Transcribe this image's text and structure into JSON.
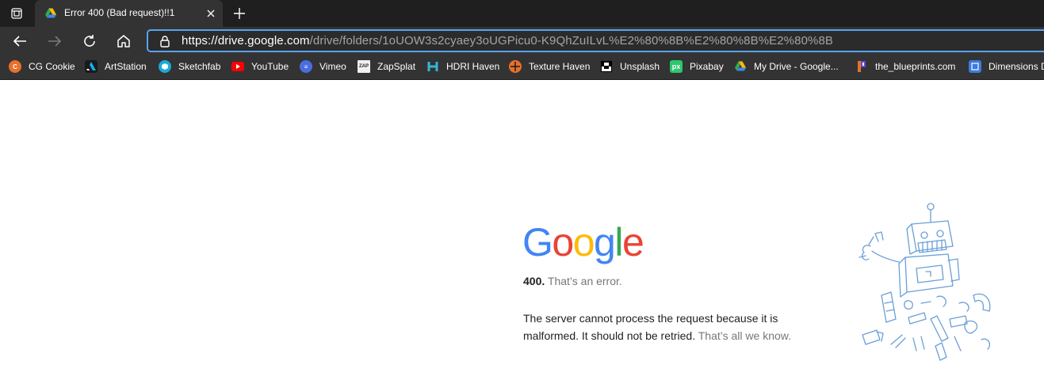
{
  "tab": {
    "title": "Error 400 (Bad request)!!1",
    "favicon": "google-drive-icon"
  },
  "toolbar": {
    "url_host": "https://drive.google.com",
    "url_path": "/drive/folders/1oUOW3s2cyaey3oUGPicu0-K9QhZuILvL%E2%80%8B%E2%80%8B%E2%80%8B"
  },
  "bookmarks": [
    {
      "label": "CG Cookie",
      "icon": "cgcookie-icon",
      "color": "#e8702a"
    },
    {
      "label": "ArtStation",
      "icon": "artstation-icon",
      "color": "#13aff0"
    },
    {
      "label": "Sketchfab",
      "icon": "sketchfab-icon",
      "color": "#1caad9"
    },
    {
      "label": "YouTube",
      "icon": "youtube-icon",
      "color": "#ff0000"
    },
    {
      "label": "Vimeo",
      "icon": "vimeo-icon",
      "color": "#4a6ee0"
    },
    {
      "label": "ZapSplat",
      "icon": "zapsplat-icon",
      "color": "#f0f0f0"
    },
    {
      "label": "HDRI Haven",
      "icon": "hdrihaven-icon",
      "color": "#36b5d8"
    },
    {
      "label": "Texture Haven",
      "icon": "texturehaven-icon",
      "color": "#e8702a"
    },
    {
      "label": "Unsplash",
      "icon": "unsplash-icon",
      "color": "#000000"
    },
    {
      "label": "Pixabay",
      "icon": "pixabay-icon",
      "color": "#2ec66e"
    },
    {
      "label": "My Drive - Google...",
      "icon": "google-drive-icon",
      "color": "#fbbc05"
    },
    {
      "label": "the_blueprints.com",
      "icon": "blueprints-icon",
      "color": "#5a4ad8"
    },
    {
      "label": "Dimensions D",
      "icon": "dimensions-icon",
      "color": "#3b7be0"
    }
  ],
  "page": {
    "logo": [
      "G",
      "o",
      "o",
      "g",
      "l",
      "e"
    ],
    "error_code": "400.",
    "error_title": "That’s an error.",
    "message": "The server cannot process the request because it is malformed. It should not be retried.",
    "message_muted": "That’s all we know."
  },
  "colors": {
    "google_blue": "#4285f4",
    "google_red": "#ea4335",
    "google_yellow": "#fbbc05",
    "google_green": "#34a853",
    "address_focus": "#5aa3f0"
  }
}
